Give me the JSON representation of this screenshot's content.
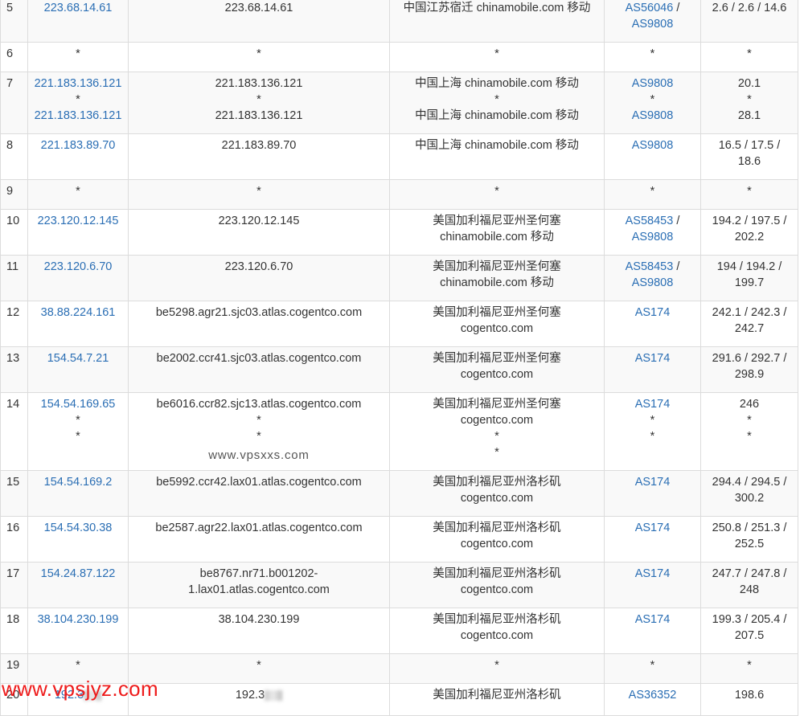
{
  "rows": [
    {
      "hop": "5",
      "ip": [
        "223.68.14.61"
      ],
      "host": [
        "223.68.14.61"
      ],
      "geo": [
        "中国江苏宿迁 chinamobile.com 移动"
      ],
      "asn": [
        [
          "AS56046",
          " /"
        ],
        [
          "AS9808",
          ""
        ]
      ],
      "rtt": [
        "2.6 / 2.6 / 14.6"
      ]
    },
    {
      "hop": "6",
      "ip": [
        "*"
      ],
      "host": [
        "*"
      ],
      "geo": [
        "*"
      ],
      "asn": [
        [
          "*",
          ""
        ]
      ],
      "rtt": [
        "*"
      ]
    },
    {
      "hop": "7",
      "ip": [
        "221.183.136.121",
        "*",
        "221.183.136.121"
      ],
      "host": [
        "221.183.136.121",
        "*",
        "221.183.136.121"
      ],
      "geo": [
        "中国上海 chinamobile.com 移动",
        "*",
        "中国上海 chinamobile.com 移动"
      ],
      "asn": [
        [
          "AS9808",
          ""
        ],
        [
          "*",
          ""
        ],
        [
          "AS9808",
          ""
        ]
      ],
      "rtt": [
        "20.1",
        "*",
        "28.1"
      ]
    },
    {
      "hop": "8",
      "ip": [
        "221.183.89.70"
      ],
      "host": [
        "221.183.89.70"
      ],
      "geo": [
        "中国上海 chinamobile.com 移动"
      ],
      "asn": [
        [
          "AS9808",
          ""
        ]
      ],
      "rtt": [
        "16.5 / 17.5 /",
        "18.6"
      ]
    },
    {
      "hop": "9",
      "ip": [
        "*"
      ],
      "host": [
        "*"
      ],
      "geo": [
        "*"
      ],
      "asn": [
        [
          "*",
          ""
        ]
      ],
      "rtt": [
        "*"
      ]
    },
    {
      "hop": "10",
      "ip": [
        "223.120.12.145"
      ],
      "host": [
        "223.120.12.145"
      ],
      "geo": [
        "美国加利福尼亚州圣何塞",
        "chinamobile.com 移动"
      ],
      "asn": [
        [
          "AS58453",
          " /"
        ],
        [
          "AS9808",
          ""
        ]
      ],
      "rtt": [
        "194.2 / 197.5 /",
        "202.2"
      ]
    },
    {
      "hop": "11",
      "ip": [
        "223.120.6.70"
      ],
      "host": [
        "223.120.6.70"
      ],
      "geo": [
        "美国加利福尼亚州圣何塞",
        "chinamobile.com 移动"
      ],
      "asn": [
        [
          "AS58453",
          " /"
        ],
        [
          "AS9808",
          ""
        ]
      ],
      "rtt": [
        "194 / 194.2 /",
        "199.7"
      ]
    },
    {
      "hop": "12",
      "ip": [
        "38.88.224.161"
      ],
      "host": [
        "be5298.agr21.sjc03.atlas.cogentco.com"
      ],
      "geo": [
        "美国加利福尼亚州圣何塞",
        "cogentco.com"
      ],
      "asn": [
        [
          "AS174",
          ""
        ]
      ],
      "rtt": [
        "242.1 / 242.3 /",
        "242.7"
      ]
    },
    {
      "hop": "13",
      "ip": [
        "154.54.7.21"
      ],
      "host": [
        "be2002.ccr41.sjc03.atlas.cogentco.com"
      ],
      "geo": [
        "美国加利福尼亚州圣何塞",
        "cogentco.com"
      ],
      "asn": [
        [
          "AS174",
          ""
        ]
      ],
      "rtt": [
        "291.6 / 292.7 /",
        "298.9"
      ]
    },
    {
      "hop": "14",
      "ip": [
        "154.54.169.65",
        "*",
        "*"
      ],
      "host": [
        "be6016.ccr82.sjc13.atlas.cogentco.com",
        "*",
        "*"
      ],
      "geo": [
        "美国加利福尼亚州圣何塞",
        "cogentco.com",
        "*",
        "*"
      ],
      "asn": [
        [
          "AS174",
          ""
        ],
        [
          "*",
          ""
        ],
        [
          "*",
          ""
        ]
      ],
      "rtt": [
        "246",
        "*",
        "*"
      ],
      "watermark": "www.vpsxxs.com"
    },
    {
      "hop": "15",
      "ip": [
        "154.54.169.2"
      ],
      "host": [
        "be5992.ccr42.lax01.atlas.cogentco.com"
      ],
      "geo": [
        "美国加利福尼亚州洛杉矶",
        "cogentco.com"
      ],
      "asn": [
        [
          "AS174",
          ""
        ]
      ],
      "rtt": [
        "294.4 / 294.5 /",
        "300.2"
      ]
    },
    {
      "hop": "16",
      "ip": [
        "154.54.30.38"
      ],
      "host": [
        "be2587.agr22.lax01.atlas.cogentco.com"
      ],
      "geo": [
        "美国加利福尼亚州洛杉矶",
        "cogentco.com"
      ],
      "asn": [
        [
          "AS174",
          ""
        ]
      ],
      "rtt": [
        "250.8 / 251.3 /",
        "252.5"
      ]
    },
    {
      "hop": "17",
      "ip": [
        "154.24.87.122"
      ],
      "host": [
        "be8767.nr71.b001202-",
        "1.lax01.atlas.cogentco.com"
      ],
      "geo": [
        "美国加利福尼亚州洛杉矶",
        "cogentco.com"
      ],
      "asn": [
        [
          "AS174",
          ""
        ]
      ],
      "rtt": [
        "247.7 / 247.8 /",
        "248"
      ]
    },
    {
      "hop": "18",
      "ip": [
        "38.104.230.199"
      ],
      "host": [
        "38.104.230.199"
      ],
      "geo": [
        "美国加利福尼亚州洛杉矶",
        "cogentco.com"
      ],
      "asn": [
        [
          "AS174",
          ""
        ]
      ],
      "rtt": [
        "199.3 / 205.4 /",
        "207.5"
      ]
    },
    {
      "hop": "19",
      "ip": [
        "*"
      ],
      "host": [
        "*"
      ],
      "geo": [
        "*"
      ],
      "asn": [
        [
          "*",
          ""
        ]
      ],
      "rtt": [
        "*"
      ]
    },
    {
      "hop": "20",
      "ip": [
        "192.3"
      ],
      "ip_blurred": true,
      "host": [
        "192.3"
      ],
      "host_blurred": true,
      "geo": [
        "美国加利福尼亚州洛杉矶"
      ],
      "asn": [
        [
          "AS36352",
          ""
        ]
      ],
      "rtt": [
        "198.6"
      ]
    }
  ],
  "brand_watermark": "www.vpsjyz.com",
  "colors": {
    "link": "#2a6eb4",
    "brand": "#ee1c1c",
    "border": "#dcdcdc",
    "stripe": "#f9f9f9"
  }
}
